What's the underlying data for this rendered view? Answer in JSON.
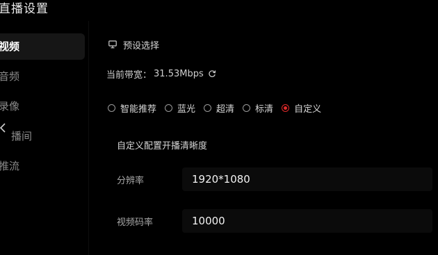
{
  "window": {
    "title": "直播设置"
  },
  "sidebar": {
    "items": [
      {
        "label": "视频",
        "active": true
      },
      {
        "label": "音频",
        "active": false
      },
      {
        "label": "录像",
        "active": false
      },
      {
        "label": "播间",
        "active": false
      },
      {
        "label": "推流",
        "active": false
      }
    ],
    "collapse_icon": "chevron-left-icon"
  },
  "main": {
    "preset": {
      "icon": "monitor-icon",
      "label": "预设选择"
    },
    "bandwidth": {
      "label": "当前带宽：",
      "value": "31.53Mbps",
      "refresh_icon": "refresh-icon"
    },
    "quality_options": [
      {
        "label": "智能推荐",
        "selected": false
      },
      {
        "label": "蓝光",
        "selected": false
      },
      {
        "label": "超清",
        "selected": false
      },
      {
        "label": "标清",
        "selected": false
      },
      {
        "label": "自定义",
        "selected": true
      }
    ],
    "custom_note": "自定义配置开播清晰度",
    "fields": {
      "resolution": {
        "label": "分辨率",
        "value": "1920*1080"
      },
      "bitrate": {
        "label": "视频码率",
        "value": "10000"
      }
    }
  },
  "colors": {
    "background": "#000000",
    "accent": "#e02a2a",
    "active_nav_bg": "#161616",
    "input_bg": "#0b0b0b"
  }
}
